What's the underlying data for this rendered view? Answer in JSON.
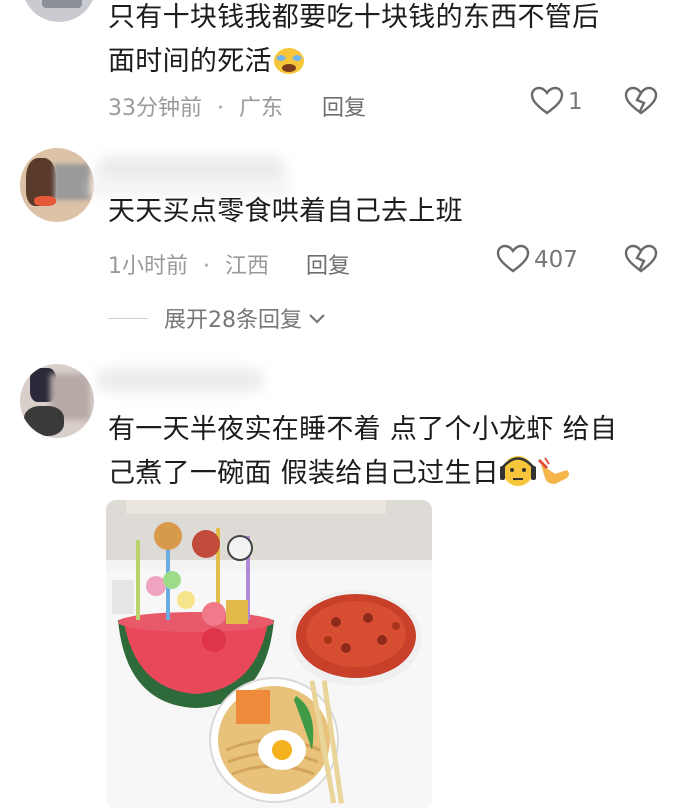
{
  "comments": [
    {
      "text_line1": "只有十块钱我都要吃十块钱的东西不管后",
      "text_line2": "面时间的死活",
      "time": "33分钟前",
      "location": "广东",
      "reply_label": "回复",
      "likes": "1"
    },
    {
      "text_line1": "天天买点零食哄着自己去上班",
      "time": "1小时前",
      "location": "江西",
      "reply_label": "回复",
      "likes": "407",
      "expand_label": "展开28条回复"
    },
    {
      "text_line1": "有一天半夜实在睡不着 点了个小龙虾 给自",
      "text_line2": "己煮了一碗面 假装给自己过生日"
    }
  ],
  "separator": "·",
  "icons": [
    "heart-icon",
    "dislike-heart-icon",
    "chevron-down-icon",
    "crying-emoji-icon",
    "nervous-emoji-icon",
    "pointing-hand-icon"
  ],
  "colors": {
    "meta": "#9a9a9a",
    "text": "#1c1c1c",
    "watermelon": "#2f6b3a",
    "crayfish": "#c8402a"
  }
}
